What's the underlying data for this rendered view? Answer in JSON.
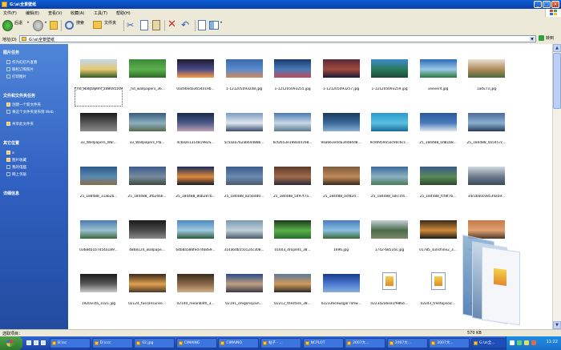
{
  "window": {
    "title": "G:\\a\\全景壁纸",
    "controls": {
      "minimize": "_",
      "maximize": "□",
      "close": "×"
    }
  },
  "menu": [
    "文件(F)",
    "编辑(E)",
    "查看(V)",
    "收藏(A)",
    "工具(T)",
    "帮助(H)"
  ],
  "toolbar": {
    "back": "后退",
    "search": "搜索",
    "folders": "文件夹"
  },
  "address": {
    "label": "地址(D)",
    "path": "G:\\a\\全景壁纸",
    "go": "转到"
  },
  "taskpane": {
    "picture_tasks": {
      "title": "图片任务",
      "items": [
        "作为幻灯片查看",
        "联机订购照片",
        "打印图片"
      ]
    },
    "file_tasks": {
      "title": "文件和文件夹任务",
      "items": [
        "创建一个新文件夹",
        "将这个文件夹发布到 Web",
        "共享此文件夹"
      ]
    },
    "other_places": {
      "title": "其它位置",
      "items": [
        "a",
        "图片收藏",
        "我的电脑",
        "网上邻居"
      ]
    },
    "details": {
      "title": "详细信息"
    }
  },
  "files": [
    {
      "name": "_hd_wallpapers_2880x1200_20080213_1411288377.jpg",
      "selected": true,
      "colors": [
        "#c0d8f0",
        "#e8c870",
        "#2e5a1e"
      ]
    },
    {
      "name": "_hd_wallpapers_36...",
      "colors": [
        "#3e8a3a",
        "#5ab04a",
        "#2e6a28"
      ]
    },
    {
      "name": "0ac66eda3654019b...",
      "colors": [
        "#1a1a2e",
        "#4a4a8a",
        "#ff9a3a"
      ]
    },
    {
      "name": "1-121205093248.jpg",
      "colors": [
        "#3a6aa8",
        "#5a8ad0",
        "#d08a5a"
      ]
    },
    {
      "name": "1-121205093255.jpg",
      "colors": [
        "#1a3a6a",
        "#4a7ab8",
        "#c04a5a"
      ]
    },
    {
      "name": "1-121205093257.jpg",
      "colors": [
        "#5a2a3a",
        "#a04a3a",
        "#1a1a3a"
      ]
    },
    {
      "name": "1-121205093259.jpg",
      "colors": [
        "#3a8ad0",
        "#2a7a5a",
        "#1a4a3a"
      ]
    },
    {
      "name": "1eever4.jpg",
      "colors": [
        "#2a6ab8",
        "#9ac8e8",
        "#2a7a3a"
      ]
    },
    {
      "name": "1adv73.jpg",
      "colors": [
        "#e8e0d0",
        "#b08a5a",
        "#4a6a3a"
      ]
    },
    {
      "name": "33_Wallpapers_Wal...",
      "colors": [
        "#1a1a1a",
        "#5a5a5a",
        "#8a8a8a"
      ]
    },
    {
      "name": "33_Wallpapers_Pla...",
      "colors": [
        "#3a5a7a",
        "#8ab0c0",
        "#5a6a4a"
      ]
    },
    {
      "name": "4cbaze131481982S...",
      "colors": [
        "#1a2a4a",
        "#4a5a8a",
        "#c0a0b0"
      ]
    },
    {
      "name": "5c5aaa762ab64488b...",
      "colors": [
        "#7a9ac0",
        "#e0e8f0",
        "#3a4a6a"
      ]
    },
    {
      "name": "6cf2653e198a44768...",
      "colors": [
        "#4a7ab0",
        "#c8d8e8",
        "#5a7a8a"
      ]
    },
    {
      "name": "9aa663e4da34484d8...",
      "colors": [
        "#1a3a5a",
        "#3a6a9a",
        "#8ab0d0"
      ]
    },
    {
      "name": "9c90959a5ac90c6cc...",
      "colors": [
        "#2a9ad0",
        "#5ac0e0",
        "#1a6a9a"
      ]
    },
    {
      "name": "25_184488_0d81b8...",
      "colors": [
        "#2a5a9a",
        "#4a7aba",
        "#e0e8f0"
      ]
    },
    {
      "name": "25_184488_0a5457c...",
      "colors": [
        "#4a6a9a",
        "#8ab0d0",
        "#2a3a5a"
      ]
    },
    {
      "name": "25_184488_31ab2b...",
      "colors": [
        "#2a5a8a",
        "#5a8ab0",
        "#8a6a4a"
      ]
    },
    {
      "name": "25_184488_3fb2466...",
      "colors": [
        "#3a5a8a",
        "#7a8aa0",
        "#3a4a3a"
      ]
    },
    {
      "name": "25_184488_80b287b...",
      "colors": [
        "#1a2a5a",
        "#e08a3a",
        "#1a1a2a"
      ]
    },
    {
      "name": "25_184488_825b480...",
      "colors": [
        "#3a5a8a",
        "#6a8ab0",
        "#4a5a6a"
      ]
    },
    {
      "name": "25_184488_5497f7a...",
      "colors": [
        "#5a3a2a",
        "#a06a4a",
        "#2a2a3a"
      ]
    },
    {
      "name": "25_184488_acf82d...",
      "colors": [
        "#7a5a3a",
        "#c08a5a",
        "#3a2a1a"
      ]
    },
    {
      "name": "25_184488_adic1f4...",
      "colors": [
        "#3a6a9a",
        "#8ab0c0",
        "#4a7a5a"
      ]
    },
    {
      "name": "25_184488_fcf8f7b...",
      "colors": [
        "#3a5a8a",
        "#5a8a5a",
        "#2a4a2a"
      ]
    },
    {
      "name": "34ccba0c08534a59...",
      "colors": [
        "#d0d8e0",
        "#6a7a8a",
        "#3a4a5a"
      ]
    },
    {
      "name": "03684b1b7d54a189...",
      "colors": [
        "#4a7ab0",
        "#9ac0d0",
        "#3a6a3a"
      ]
    },
    {
      "name": "4868124_wallpape...",
      "colors": [
        "#1a1a1a",
        "#4a4a4a",
        "#8a8a8a"
      ]
    },
    {
      "name": "64b8a586fed7468S9...",
      "colors": [
        "#4a8ac0",
        "#a0c8e0",
        "#2a5a3a"
      ]
    },
    {
      "name": "314a6db550124c308...",
      "colors": [
        "#7a9ab0",
        "#c0d0d8",
        "#4a5a6a"
      ]
    },
    {
      "name": "01603_droplets_38...",
      "colors": [
        "#1a3a1a",
        "#5ab04a",
        "#2a6a2a"
      ]
    },
    {
      "name": "1696.jpg",
      "colors": [
        "#4a7ac0",
        "#8ac0e0",
        "#3a6a3a"
      ]
    },
    {
      "name": "1742-68516s.jpg",
      "colors": [
        "#c8d0d8",
        "#4a6a4a",
        "#7a8a6a"
      ]
    },
    {
      "name": "01785_sunshine2_3...",
      "colors": [
        "#3a2a1a",
        "#d08a3a",
        "#1a1a1a"
      ]
    },
    {
      "name": "01800_stillsunset_...",
      "colors": [
        "#c87a4a",
        "#e0a070",
        "#4a3a2a"
      ]
    },
    {
      "name": "1920vista_1021.jpg",
      "colors": [
        "#1a1a1a",
        "#5a5a5a",
        "#cacaca"
      ]
    },
    {
      "name": "02124_tuscansunse...",
      "colors": [
        "#3a2a1a",
        "#e0a050",
        "#4a3a2a"
      ]
    },
    {
      "name": "02140_reeanbath_3...",
      "colors": [
        "#3a2a1a",
        "#8a6a4a",
        "#d0b080"
      ]
    },
    {
      "name": "02191_oregonspain...",
      "colors": [
        "#2a4a8a",
        "#c0a080",
        "#3a3a4a"
      ]
    },
    {
      "name": "02212_thestare_38...",
      "colors": [
        "#5a7a9a",
        "#d09a5a",
        "#2a2a2a"
      ]
    },
    {
      "name": "022336cewsgar7ahw...",
      "colors": [
        "#1a3a8a",
        "#4a7ad0",
        "#8ab0e0"
      ]
    },
    {
      "name": "022342a6ea1f986ci...",
      "doc": true
    },
    {
      "name": "02243_treetopsoic...",
      "doc": true
    },
    {
      "name": "02262_tremtzed...",
      "doc": true
    }
  ],
  "status": {
    "left": "选取项目：",
    "size": "570 KB"
  },
  "taskbar": {
    "tasks": [
      "B:\\ac",
      "D:\\ccc",
      "02.jpg",
      "CIMAING",
      "CIMAINO",
      "帖子 - ...",
      "NCPLOT",
      "2007大...",
      "2007大...",
      "2007大...",
      "G:\\a\\全..."
    ],
    "clock": "11:22"
  },
  "colors": {
    "accent": "#0a3fa8",
    "taskpane": "#2f5fc0"
  }
}
